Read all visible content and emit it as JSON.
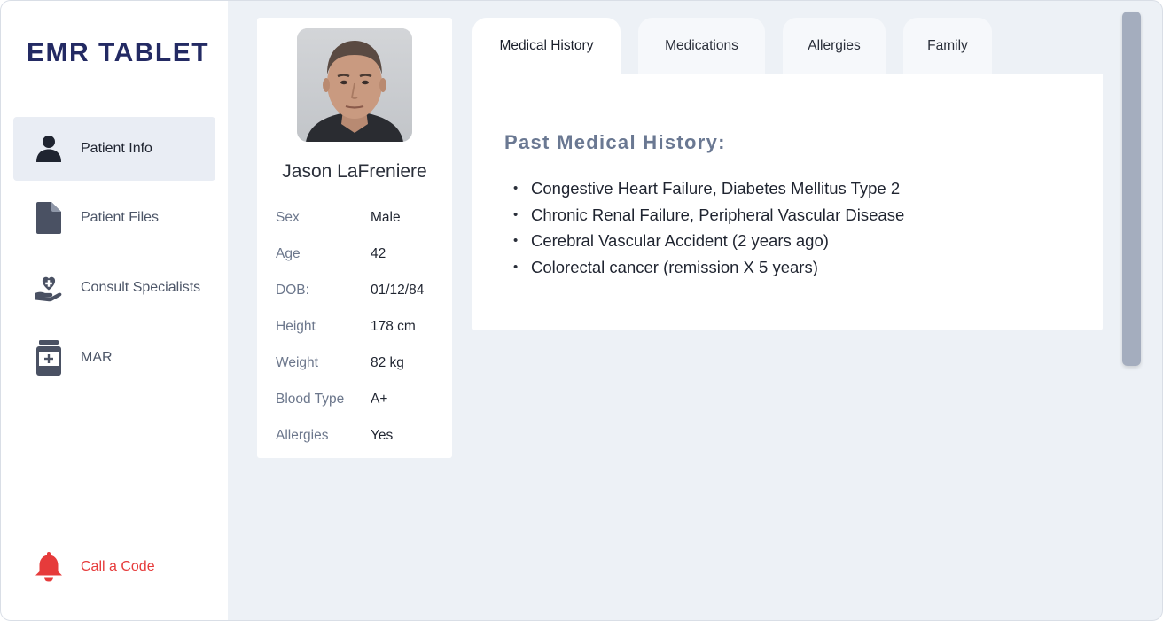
{
  "app": {
    "title": "EMR TABLET"
  },
  "sidebar": {
    "items": [
      {
        "label": "Patient Info",
        "icon": "user-icon",
        "active": true
      },
      {
        "label": "Patient Files",
        "icon": "file-icon",
        "active": false
      },
      {
        "label": "Consult Specialists",
        "icon": "hand-heart-icon",
        "active": false
      },
      {
        "label": "MAR",
        "icon": "medicine-bottle-icon",
        "active": false
      }
    ],
    "alert": {
      "label": "Call a Code",
      "icon": "bell-icon",
      "color": "#e63b3b"
    }
  },
  "patient": {
    "name": "Jason LaFreniere",
    "fields": [
      {
        "key": "Sex",
        "value": "Male"
      },
      {
        "key": "Age",
        "value": "42"
      },
      {
        "key": "DOB:",
        "value": "01/12/84"
      },
      {
        "key": "Height",
        "value": "178 cm"
      },
      {
        "key": "Weight",
        "value": "82 kg"
      },
      {
        "key": "Blood Type",
        "value": "A+"
      },
      {
        "key": "Allergies",
        "value": "Yes"
      }
    ]
  },
  "tabs": [
    {
      "label": "Medical History",
      "active": true
    },
    {
      "label": "Medications",
      "active": false
    },
    {
      "label": "Allergies",
      "active": false
    },
    {
      "label": "Family",
      "active": false
    }
  ],
  "history": {
    "title": "Past Medical History:",
    "items": [
      "Congestive Heart Failure, Diabetes Mellitus Type 2",
      "Chronic Renal Failure, Peripheral Vascular Disease",
      "Cerebral Vascular Accident (2 years ago)",
      "Colorectal cancer (remission X 5 years)"
    ]
  },
  "colors": {
    "brand": "#232a63",
    "sidebar_active_bg": "#e9edf4",
    "alert": "#e63b3b",
    "icon": "#4a5163",
    "app_bg": "#edf1f6"
  }
}
